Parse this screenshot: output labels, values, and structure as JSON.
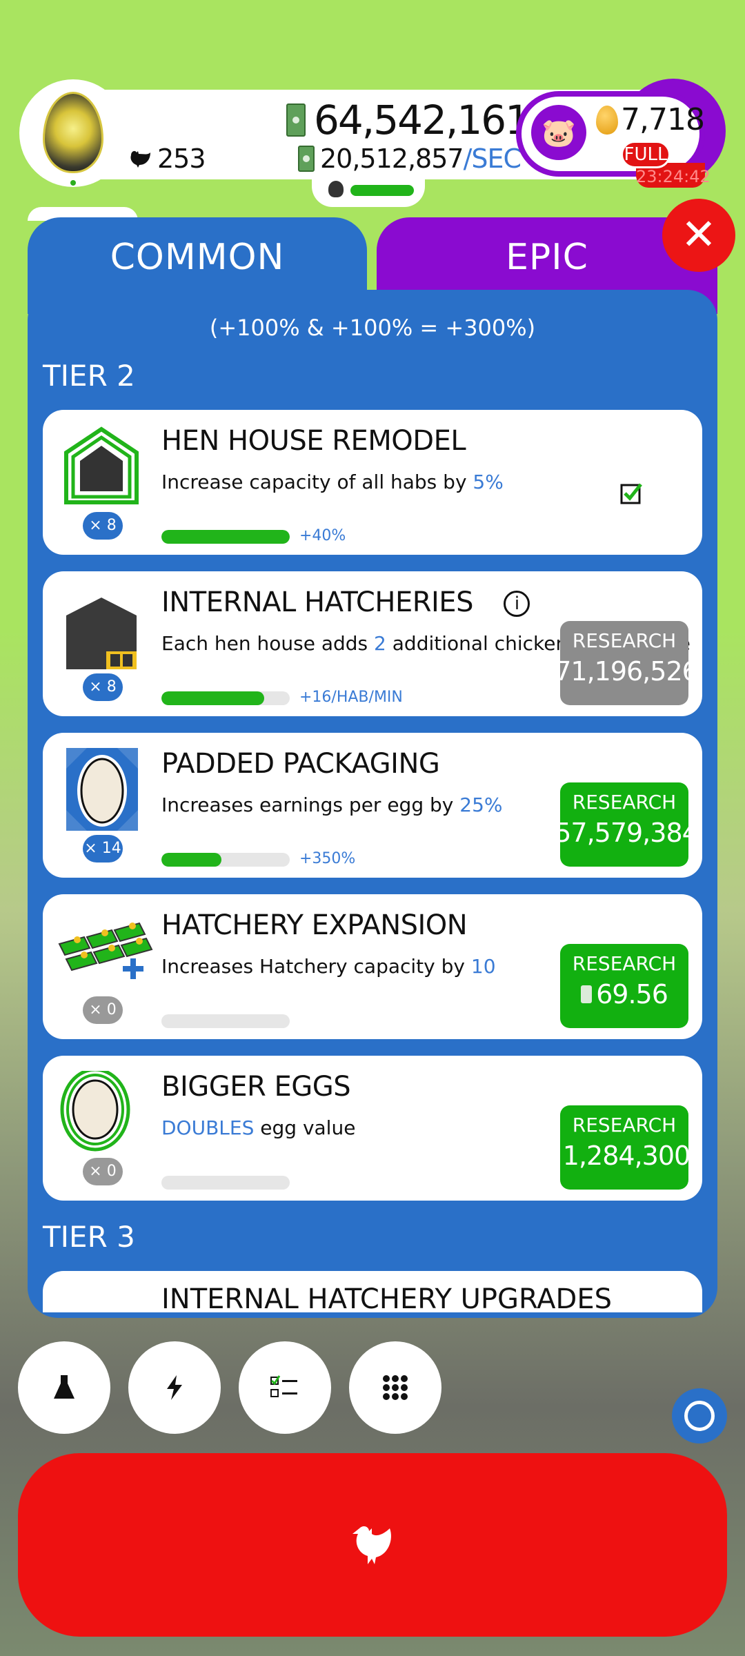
{
  "header": {
    "chickens": "253",
    "money": "64,542,161",
    "money_rate": "20,512,857",
    "money_rate_unit": "/SEC",
    "golden_eggs": "7,718",
    "full_badge": "FULL",
    "timer": "23:24:42"
  },
  "tabs": [
    {
      "label": "COMMON",
      "selected": true
    },
    {
      "label": "EPIC",
      "selected": false
    }
  ],
  "close_label": "✕",
  "summary": "(+100% & +100% = +300%)",
  "tiers": [
    "TIER 2",
    "TIER 3"
  ],
  "research": [
    {
      "name": "HEN HOUSE REMODEL",
      "desc_prefix": "Increase capacity of all habs by ",
      "desc_highlight": "5%",
      "desc_suffix": "",
      "level": "× 8",
      "progress": 1.0,
      "bar_label": "+40%",
      "completed": true
    },
    {
      "name": "INTERNAL HATCHERIES",
      "desc_prefix": "Each hen house adds ",
      "desc_highlight": "2",
      "desc_suffix": " additional chickens per minute",
      "level": "× 8",
      "progress": 0.8,
      "bar_label": "+16/HAB/MIN",
      "button": {
        "label": "RESEARCH",
        "price": "71,196,526",
        "enabled": false
      }
    },
    {
      "name": "PADDED PACKAGING",
      "desc_prefix": "Increases earnings per egg by ",
      "desc_highlight": "25%",
      "desc_suffix": "",
      "level": "× 14",
      "progress": 0.47,
      "bar_label": "+350%",
      "button": {
        "label": "RESEARCH",
        "price": "57,579,384",
        "enabled": true
      }
    },
    {
      "name": "HATCHERY EXPANSION",
      "desc_prefix": "Increases Hatchery capacity by ",
      "desc_highlight": "10",
      "desc_suffix": "",
      "level": "× 0",
      "progress": 0,
      "bar_label": "",
      "button": {
        "label": "RESEARCH",
        "price": "69.56",
        "enabled": true
      }
    },
    {
      "name": "BIGGER EGGS",
      "desc_prefix": "",
      "desc_highlight": "DOUBLES",
      "desc_suffix": " egg value",
      "level": "× 0",
      "progress": 0,
      "bar_label": "",
      "button": {
        "label": "RESEARCH",
        "price": "1,284,300",
        "enabled": true
      }
    }
  ],
  "next_card_name": "INTERNAL HATCHERY UPGRADES",
  "colors": {
    "accent_blue": "#2a70c8",
    "epic_purple": "#8a0bd0",
    "research_green": "#12b010",
    "hatch_red": "#ee1111"
  }
}
